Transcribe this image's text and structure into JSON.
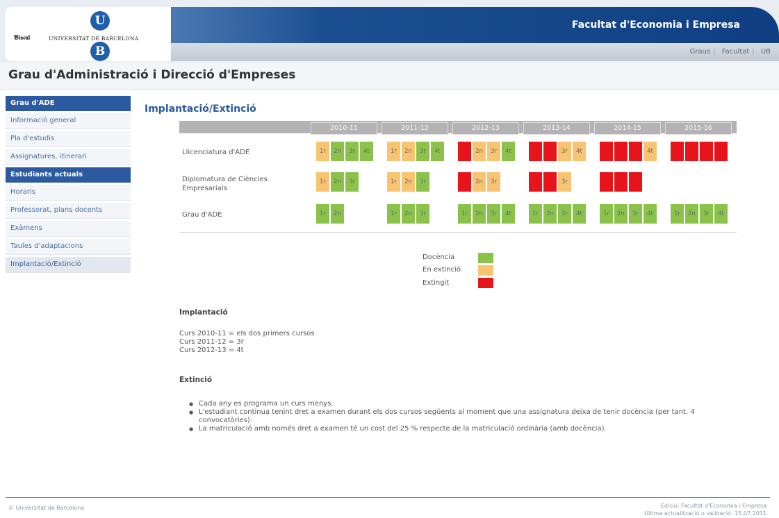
{
  "header": {
    "university_mark": "𝕭𝖎𝖘𝖈𝖆𝖑",
    "university_name": "UNIVERSITAT DE BARCELONA",
    "logo_letter_top": "U",
    "logo_letter_bottom": "B",
    "faculty_title": "Facultat d'Economia i Empresa",
    "nav_links": [
      "Graus",
      "Facultat",
      "UB"
    ]
  },
  "page_title": "Grau d'Administració i Direcció d'Empreses",
  "sidebar": {
    "sections": [
      {
        "heading": "Grau d'ADE",
        "items": [
          "Informació general",
          "Pla d'estudis",
          "Assignatures, itinerari"
        ]
      },
      {
        "heading": "Estudiants actuals",
        "items": [
          "Horaris",
          "Professorat, plans docents",
          "Exàmens",
          "Taules d'adaptacions",
          "Implantació/Extinció"
        ]
      }
    ],
    "active_item": "Implantació/Extinció"
  },
  "main": {
    "section_title": "Implantació/Extinció",
    "years": [
      "2010-11",
      "2011-12",
      "2012-13",
      "2013-14",
      "2014-15",
      "2015-16"
    ],
    "status_colors": {
      "doc": "#8bc34a",
      "ext": "#f8c471",
      "fin": "#e8141b"
    },
    "rows": [
      {
        "label": "Llicenciatura d'ADE",
        "years": [
          [
            [
              "1r",
              "ext"
            ],
            [
              "2n",
              "doc"
            ],
            [
              "3r",
              "doc"
            ],
            [
              "4t",
              "doc"
            ]
          ],
          [
            [
              "1r",
              "ext"
            ],
            [
              "2n",
              "ext"
            ],
            [
              "3r",
              "doc"
            ],
            [
              "4t",
              "doc"
            ]
          ],
          [
            [
              "",
              "fin"
            ],
            [
              "2n",
              "ext"
            ],
            [
              "3r",
              "ext"
            ],
            [
              "4t",
              "doc"
            ]
          ],
          [
            [
              "",
              "fin"
            ],
            [
              "",
              "fin"
            ],
            [
              "3r",
              "ext"
            ],
            [
              "4t",
              "ext"
            ]
          ],
          [
            [
              "",
              "fin"
            ],
            [
              "",
              "fin"
            ],
            [
              "",
              "fin"
            ],
            [
              "4t",
              "ext"
            ]
          ],
          [
            [
              "",
              "fin"
            ],
            [
              "",
              "fin"
            ],
            [
              "",
              "fin"
            ],
            [
              "",
              "fin"
            ]
          ]
        ]
      },
      {
        "label": "Diplomatura de Ciències Empresarials",
        "years": [
          [
            [
              "1r",
              "ext"
            ],
            [
              "2n",
              "doc"
            ],
            [
              "3r",
              "doc"
            ]
          ],
          [
            [
              "1r",
              "ext"
            ],
            [
              "2n",
              "ext"
            ],
            [
              "3r",
              "doc"
            ]
          ],
          [
            [
              "",
              "fin"
            ],
            [
              "2n",
              "ext"
            ],
            [
              "3r",
              "ext"
            ]
          ],
          [
            [
              "",
              "fin"
            ],
            [
              "",
              "fin"
            ],
            [
              "3r",
              "ext"
            ]
          ],
          [
            [
              "",
              "fin"
            ],
            [
              "",
              "fin"
            ],
            [
              "",
              "fin"
            ]
          ],
          []
        ]
      },
      {
        "label": "Grau d'ADE",
        "years": [
          [
            [
              "1r",
              "doc"
            ],
            [
              "2n",
              "doc"
            ]
          ],
          [
            [
              "1r",
              "doc"
            ],
            [
              "2n",
              "doc"
            ],
            [
              "3r",
              "doc"
            ]
          ],
          [
            [
              "1r",
              "doc"
            ],
            [
              "2n",
              "doc"
            ],
            [
              "3r",
              "doc"
            ],
            [
              "4t",
              "doc"
            ]
          ],
          [
            [
              "1r",
              "doc"
            ],
            [
              "2n",
              "doc"
            ],
            [
              "3r",
              "doc"
            ],
            [
              "4t",
              "doc"
            ]
          ],
          [
            [
              "1r",
              "doc"
            ],
            [
              "2n",
              "doc"
            ],
            [
              "3r",
              "doc"
            ],
            [
              "4t",
              "doc"
            ]
          ],
          [
            [
              "1r",
              "doc"
            ],
            [
              "2n",
              "doc"
            ],
            [
              "3r",
              "doc"
            ],
            [
              "4t",
              "doc"
            ]
          ]
        ]
      }
    ],
    "legend": [
      {
        "label": "Docència",
        "status": "doc"
      },
      {
        "label": "En extinció",
        "status": "ext"
      },
      {
        "label": "Extingit",
        "status": "fin"
      }
    ],
    "implantacio": {
      "heading": "Implantació",
      "lines": [
        "Curs 2010-11 = els dos primers cursos",
        "Curs 2011-12 = 3r",
        "Curs 2012-13 = 4t"
      ]
    },
    "extincio": {
      "heading": "Extinció",
      "bullets": [
        "Cada any es programa un curs menys.",
        "L'estudiant continua tenint dret a examen durant els dos cursos següents al moment que una assignatura deixa de tenir docència (per tant, 4 convocatòries).",
        "La matriculació amb només dret a examen té un cost del 25 % respecte de la matriculació ordinària (amb docència)."
      ]
    }
  },
  "footer": {
    "copyright": "© Universitat de Barcelona",
    "edition": "Edició: Facultat d'Economia i Empresa",
    "updated": "Última actualització o validació: 15.07.2011"
  }
}
